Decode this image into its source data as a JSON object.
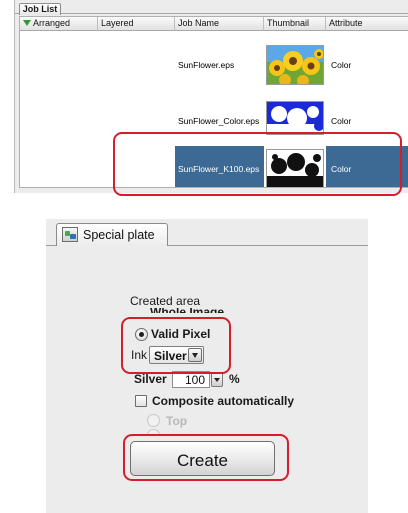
{
  "job_list": {
    "tab_label": "Job List",
    "columns": [
      "Arranged",
      "Layered",
      "Job Name",
      "Thumbnail",
      "Attribute"
    ],
    "rows": [
      {
        "job_name": "SunFlower.eps",
        "attribute": "Color",
        "thumbnail": "sunflower-color-thumbnail",
        "selected": false
      },
      {
        "job_name": "SunFlower_Color.eps",
        "attribute": "Color",
        "thumbnail": "sunflower-white-silhouette-thumbnail",
        "selected": false
      },
      {
        "job_name": "SunFlower_K100.eps",
        "attribute": "Color",
        "thumbnail": "sunflower-black-silhouette-thumbnail",
        "selected": true
      }
    ]
  },
  "special_plate": {
    "tab_label": "Special plate",
    "tab_icon": "special-plate-icon",
    "created_area_label": "Created area",
    "whole_image_label": "Whole Image",
    "valid_pixel_label": "Valid Pixel",
    "ink_label": "Ink",
    "ink_value": "Silver",
    "silver_label": "Silver",
    "silver_value": "100",
    "percent_label": "%",
    "composite_label": "Composite automatically",
    "top_label": "Top",
    "create_label": "Create"
  },
  "colors": {
    "selection": "#3d6a94",
    "highlight": "#d41e2b",
    "panel": "#ececec"
  }
}
